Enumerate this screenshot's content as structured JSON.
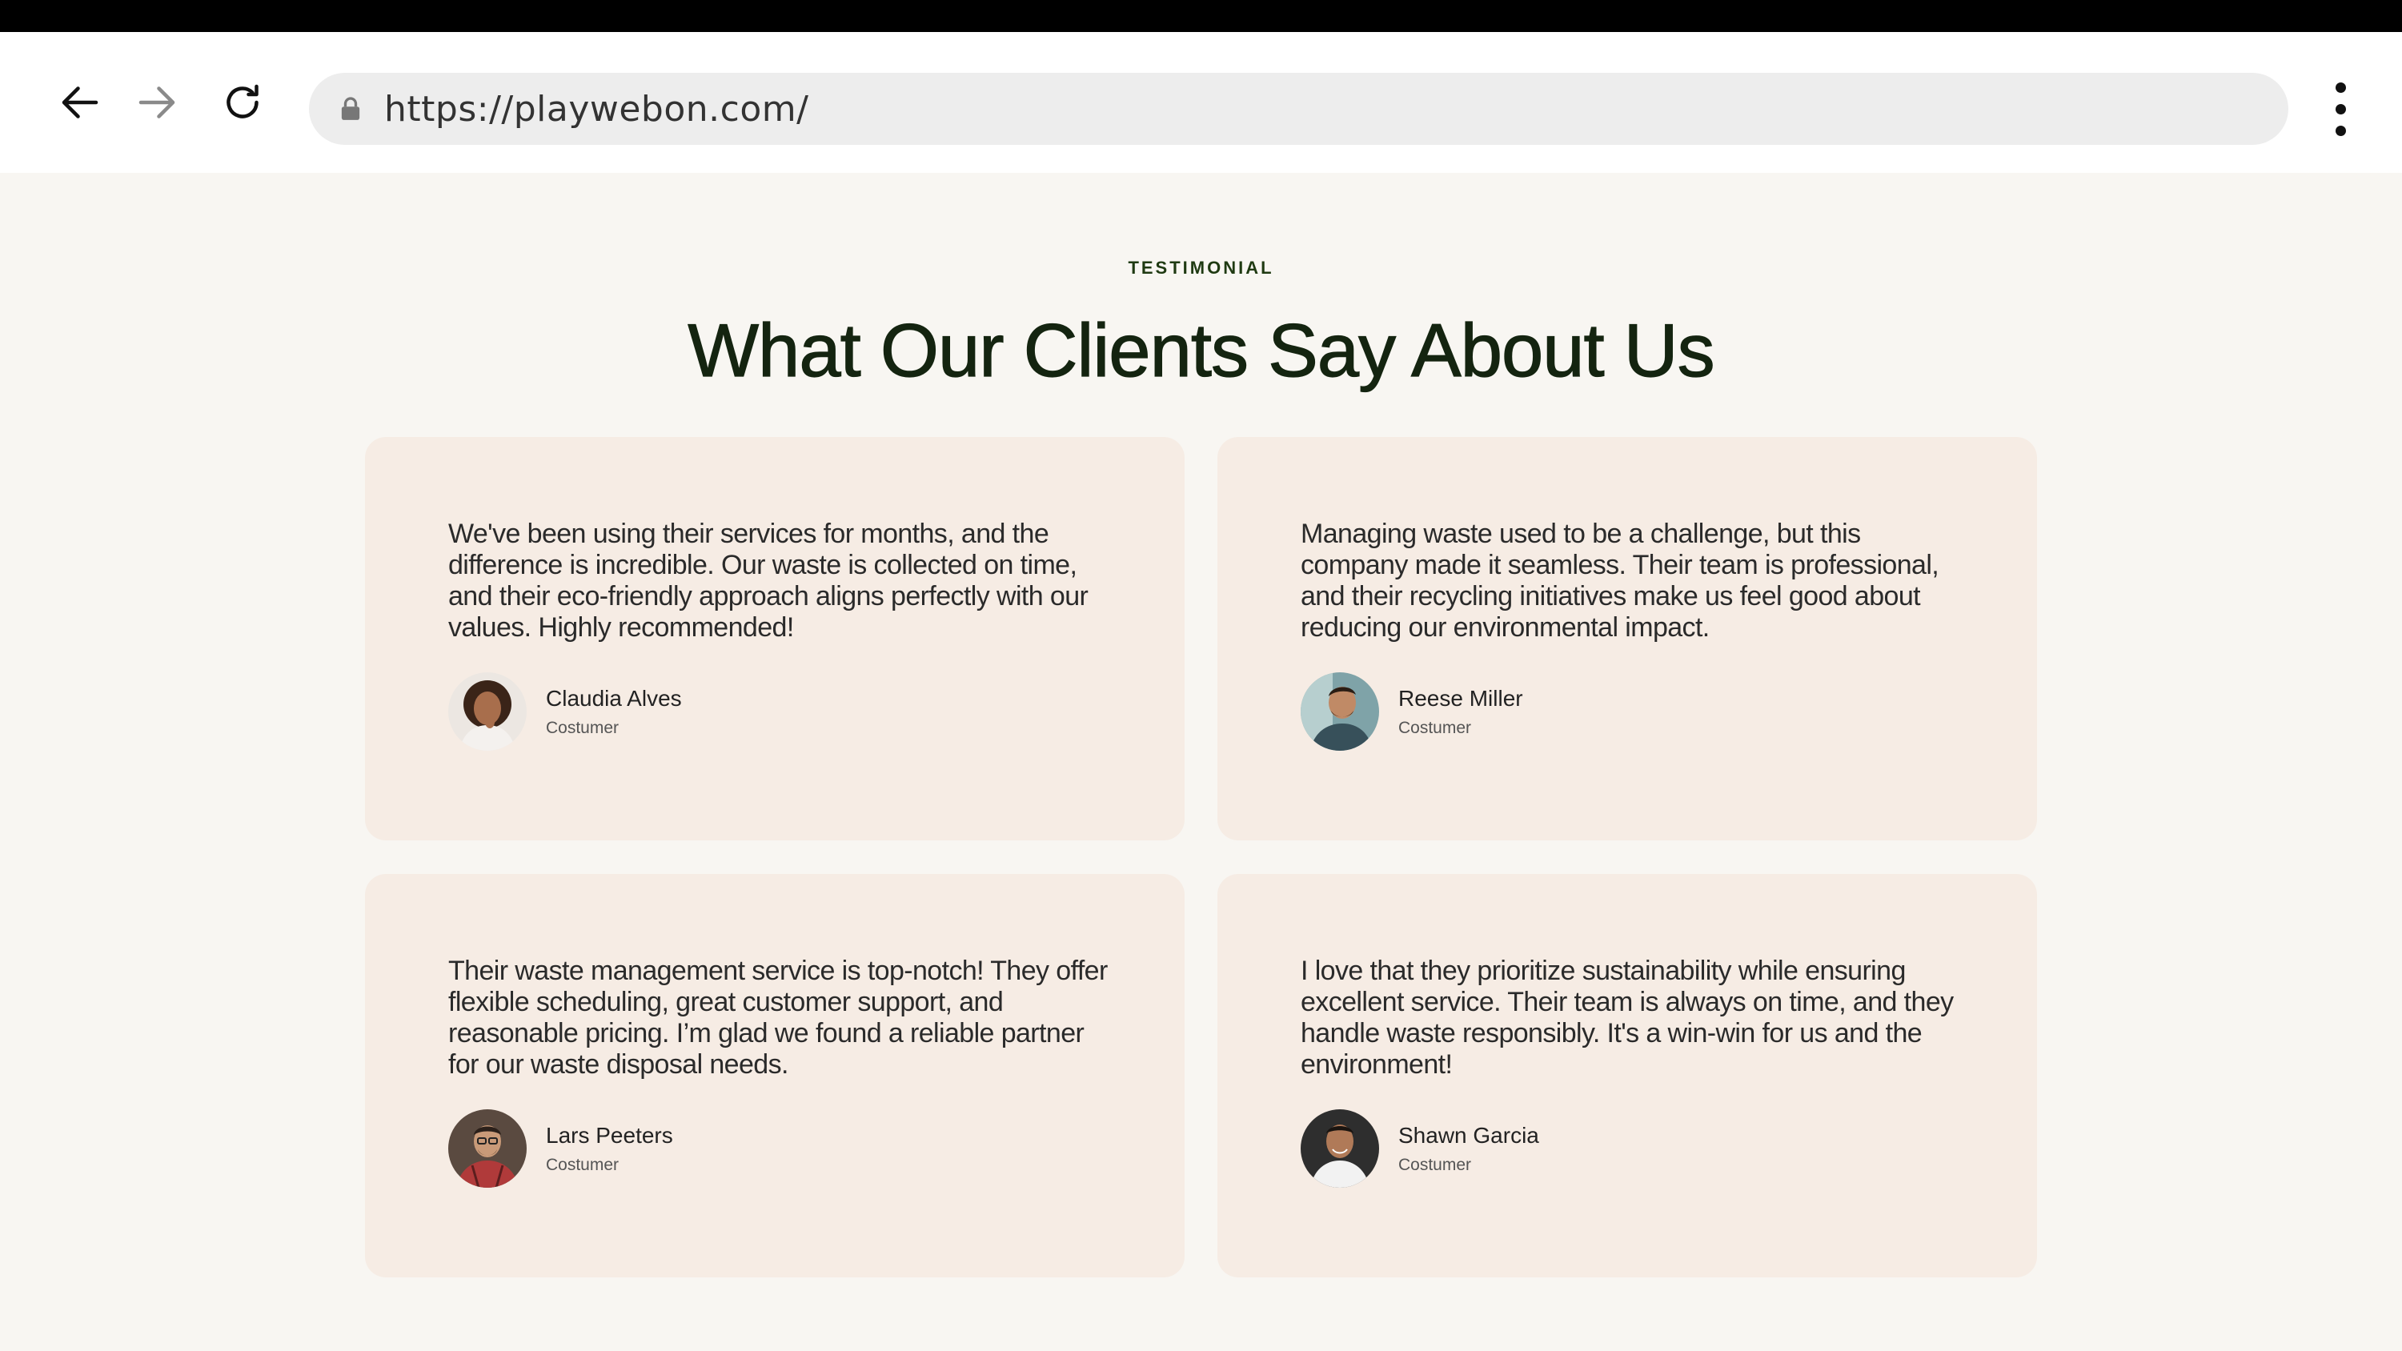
{
  "browser": {
    "url": "https://playwebon.com/"
  },
  "section": {
    "eyebrow": "TESTIMONIAL",
    "heading": "What Our Clients Say About Us"
  },
  "testimonials": [
    {
      "quote": "We've been using their services for months, and the difference is incredible. Our waste is collected on time, and their eco-friendly approach aligns perfectly with our values. Highly recommended!",
      "name": "Claudia Alves",
      "role": "Costumer"
    },
    {
      "quote": "Managing waste used to be a challenge, but this company made it seamless. Their team is professional, and their recycling initiatives make us feel good about reducing our environmental impact.",
      "name": "Reese Miller",
      "role": "Costumer"
    },
    {
      "quote": "Their waste management service is top-notch! They offer flexible scheduling, great customer support, and reasonable pricing. I’m glad we found a reliable partner for our waste disposal needs.",
      "name": "Lars Peeters",
      "role": "Costumer"
    },
    {
      "quote": "I love that they prioritize sustainability while ensuring excellent service. Their team is always on time, and they handle waste responsibly. It's a win-win for us and the environment!",
      "name": "Shawn Garcia",
      "role": "Costumer"
    }
  ],
  "colors": {
    "page_background": "#f8f6f2",
    "card_background": "#f6ece4",
    "heading": "#142410",
    "eyebrow": "#1f3a12"
  }
}
